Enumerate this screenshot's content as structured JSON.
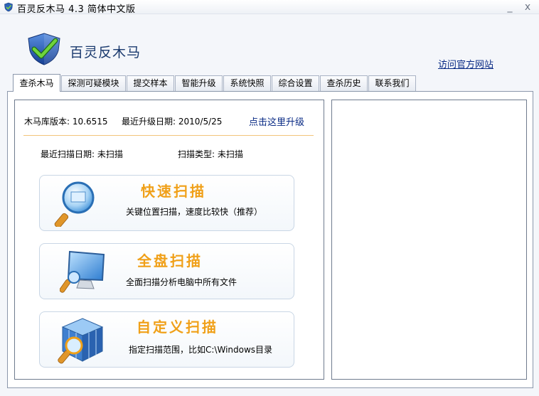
{
  "window": {
    "title": "百灵反木马 4.3 简体中文版",
    "minimize_glyph": "_",
    "close_glyph": "x"
  },
  "header": {
    "brand": "百灵反木马",
    "official_link": "访问官方网站"
  },
  "tabs": [
    {
      "label": "查杀木马",
      "active": true
    },
    {
      "label": "探测可疑模块",
      "active": false
    },
    {
      "label": "提交样本",
      "active": false
    },
    {
      "label": "智能升级",
      "active": false
    },
    {
      "label": "系统快照",
      "active": false
    },
    {
      "label": "综合设置",
      "active": false
    },
    {
      "label": "查杀历史",
      "active": false
    },
    {
      "label": "联系我们",
      "active": false
    }
  ],
  "info": {
    "db_version": "木马库版本: 10.6515",
    "last_upgrade": "最近升级日期: 2010/5/25",
    "upgrade_link": "点击这里升级",
    "last_scan": "最近扫描日期: 未扫描",
    "scan_type": "扫描类型: 未扫描"
  },
  "scans": [
    {
      "title": "快速扫描",
      "desc": "关键位置扫描，速度比较快（推荐）",
      "icon": "magnifier-icon"
    },
    {
      "title": "全盘扫描",
      "desc": "全面扫描分析电脑中所有文件",
      "icon": "monitor-icon"
    },
    {
      "title": "自定义扫描",
      "desc": "指定扫描范围，比如C:\\Windows目录",
      "icon": "cube-icon"
    }
  ],
  "colors": {
    "accent": "#f0a018",
    "link": "#0a2b85",
    "border": "#8b97ab"
  }
}
